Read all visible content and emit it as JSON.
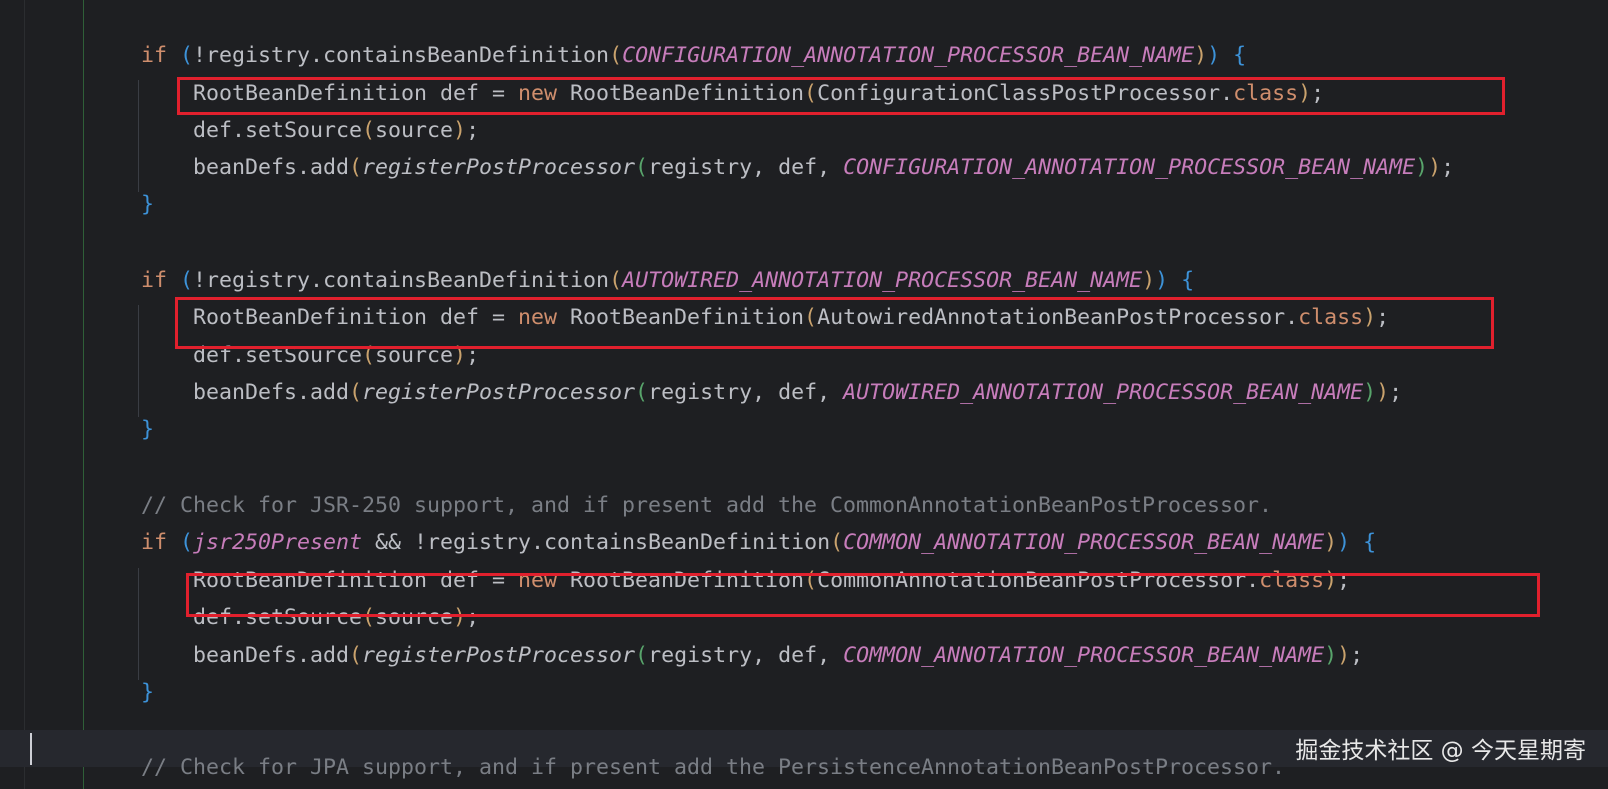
{
  "editor": {
    "lines": [
      {
        "id": "l1",
        "segments": [
          [
            "kw",
            "if "
          ],
          [
            "bl",
            "("
          ],
          [
            "",
            "!registry.containsBeanDefinition"
          ],
          [
            "pr",
            "("
          ],
          [
            "const",
            "CONFIGURATION_ANNOTATION_PROCESSOR_BEAN_NAME"
          ],
          [
            "pr",
            ")"
          ],
          [
            "bl",
            ")"
          ],
          [
            "",
            " "
          ],
          [
            "bl",
            "{"
          ]
        ]
      },
      {
        "id": "l2",
        "segments": [
          [
            "",
            "    RootBeanDefinition def = "
          ],
          [
            "kw",
            "new "
          ],
          [
            "",
            "RootBeanDefinition"
          ],
          [
            "pr",
            "("
          ],
          [
            "",
            "ConfigurationClassPostProcessor."
          ],
          [
            "kw",
            "class"
          ],
          [
            "pr",
            ")"
          ],
          [
            "",
            ";"
          ]
        ]
      },
      {
        "id": "l3",
        "segments": [
          [
            "",
            "    def.setSource"
          ],
          [
            "pr",
            "("
          ],
          [
            "",
            "source"
          ],
          [
            "pr",
            ")"
          ],
          [
            "",
            ";"
          ]
        ]
      },
      {
        "id": "l4",
        "segments": [
          [
            "",
            "    beanDefs.add"
          ],
          [
            "pr",
            "("
          ],
          [
            "fn",
            "registerPostProcessor"
          ],
          [
            "pg",
            "("
          ],
          [
            "",
            "registry, def, "
          ],
          [
            "const",
            "CONFIGURATION_ANNOTATION_PROCESSOR_BEAN_NAME"
          ],
          [
            "pg",
            ")"
          ],
          [
            "pr",
            ")"
          ],
          [
            "",
            ";"
          ]
        ]
      },
      {
        "id": "l5",
        "segments": [
          [
            "bl",
            "}"
          ]
        ]
      },
      {
        "id": "l6",
        "segments": []
      },
      {
        "id": "l7",
        "segments": [
          [
            "kw",
            "if "
          ],
          [
            "bl",
            "("
          ],
          [
            "",
            "!registry.containsBeanDefinition"
          ],
          [
            "pr",
            "("
          ],
          [
            "const",
            "AUTOWIRED_ANNOTATION_PROCESSOR_BEAN_NAME"
          ],
          [
            "pr",
            ")"
          ],
          [
            "bl",
            ")"
          ],
          [
            "",
            " "
          ],
          [
            "bl",
            "{"
          ]
        ]
      },
      {
        "id": "l8",
        "segments": [
          [
            "",
            "    RootBeanDefinition def = "
          ],
          [
            "kw",
            "new "
          ],
          [
            "",
            "RootBeanDefinition"
          ],
          [
            "pr",
            "("
          ],
          [
            "",
            "AutowiredAnnotationBeanPostProcessor."
          ],
          [
            "kw",
            "class"
          ],
          [
            "pr",
            ")"
          ],
          [
            "",
            ";"
          ]
        ]
      },
      {
        "id": "l9",
        "segments": [
          [
            "",
            "    def.setSource"
          ],
          [
            "pr",
            "("
          ],
          [
            "",
            "source"
          ],
          [
            "pr",
            ")"
          ],
          [
            "",
            ";"
          ]
        ]
      },
      {
        "id": "l10",
        "segments": [
          [
            "",
            "    beanDefs.add"
          ],
          [
            "pr",
            "("
          ],
          [
            "fn",
            "registerPostProcessor"
          ],
          [
            "pg",
            "("
          ],
          [
            "",
            "registry, def, "
          ],
          [
            "const",
            "AUTOWIRED_ANNOTATION_PROCESSOR_BEAN_NAME"
          ],
          [
            "pg",
            ")"
          ],
          [
            "pr",
            ")"
          ],
          [
            "",
            ";"
          ]
        ]
      },
      {
        "id": "l11",
        "segments": [
          [
            "bl",
            "}"
          ]
        ]
      },
      {
        "id": "l12",
        "segments": []
      },
      {
        "id": "l13",
        "segments": [
          [
            "cmt",
            "// Check for JSR-250 support, and if present add the CommonAnnotationBeanPostProcessor."
          ]
        ]
      },
      {
        "id": "l14",
        "segments": [
          [
            "kw",
            "if "
          ],
          [
            "bl",
            "("
          ],
          [
            "const",
            "jsr250Present"
          ],
          [
            "",
            " && !registry.containsBeanDefinition"
          ],
          [
            "pr",
            "("
          ],
          [
            "const",
            "COMMON_ANNOTATION_PROCESSOR_BEAN_NAME"
          ],
          [
            "pr",
            ")"
          ],
          [
            "bl",
            ")"
          ],
          [
            "",
            " "
          ],
          [
            "bl",
            "{"
          ]
        ]
      },
      {
        "id": "l15",
        "segments": [
          [
            "",
            "    RootBeanDefinition def = "
          ],
          [
            "kw",
            "new "
          ],
          [
            "",
            "RootBeanDefinition"
          ],
          [
            "pr",
            "("
          ],
          [
            "",
            "CommonAnnotationBeanPostProcessor."
          ],
          [
            "kw",
            "class"
          ],
          [
            "pr",
            ")"
          ],
          [
            "",
            ";"
          ]
        ]
      },
      {
        "id": "l16",
        "segments": [
          [
            "",
            "    def.setSource"
          ],
          [
            "pr",
            "("
          ],
          [
            "",
            "source"
          ],
          [
            "pr",
            ")"
          ],
          [
            "",
            ";"
          ]
        ]
      },
      {
        "id": "l17",
        "segments": [
          [
            "",
            "    beanDefs.add"
          ],
          [
            "pr",
            "("
          ],
          [
            "fn",
            "registerPostProcessor"
          ],
          [
            "pg",
            "("
          ],
          [
            "",
            "registry, def, "
          ],
          [
            "const",
            "COMMON_ANNOTATION_PROCESSOR_BEAN_NAME"
          ],
          [
            "pg",
            ")"
          ],
          [
            "pr",
            ")"
          ],
          [
            "",
            ";"
          ]
        ]
      },
      {
        "id": "l18",
        "segments": [
          [
            "bl",
            "}"
          ]
        ]
      },
      {
        "id": "l19",
        "segments": []
      },
      {
        "id": "l20",
        "segments": [
          [
            "cmt",
            "// Check for JPA support, and if present add the PersistenceAnnotationBeanPostProcessor."
          ]
        ]
      }
    ]
  },
  "watermark": "掘金技术社区 @ 今天星期寄",
  "colors": {
    "background": "#1e1f22",
    "keyword": "#cf8e6d",
    "constant": "#c77dbb",
    "comment": "#7a7e85",
    "highlight_box": "#e1202d"
  }
}
